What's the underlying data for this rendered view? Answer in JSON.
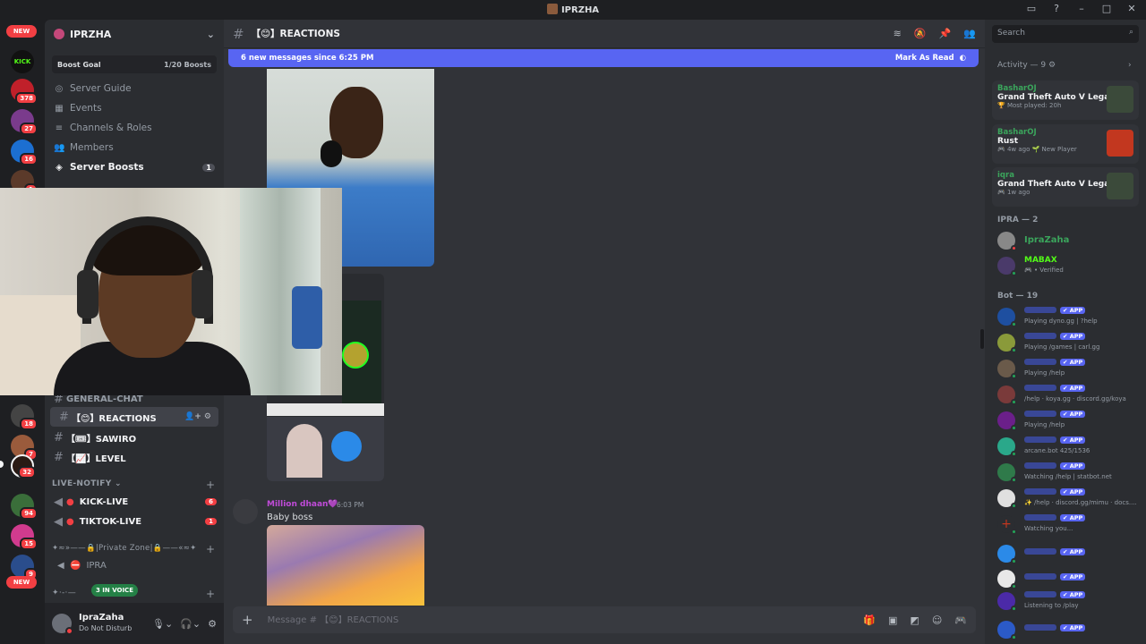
{
  "window": {
    "title": "IPRZHA"
  },
  "rail": {
    "new_label": "NEW",
    "kick_label": "KICK",
    "servers": [
      {
        "badge": "378"
      },
      {
        "badge": "27"
      },
      {
        "badge": "16"
      },
      {
        "badge": "1"
      },
      {
        "badge": "18"
      },
      {
        "badge": "7"
      },
      {
        "badge": "32"
      },
      {
        "badge": "94"
      },
      {
        "badge": "15"
      },
      {
        "badge": "9"
      }
    ],
    "new_label_bottom": "NEW"
  },
  "sidebar": {
    "server_name": "IPRZHA",
    "boost_goal": {
      "label": "Boost Goal",
      "value": "1/20 Boosts"
    },
    "nav": [
      {
        "label": "Server Guide",
        "icon": "compass-icon"
      },
      {
        "label": "Events",
        "icon": "calendar-icon"
      },
      {
        "label": "Channels & Roles",
        "icon": "list-icon"
      },
      {
        "label": "Members",
        "icon": "members-icon"
      },
      {
        "label": "Server Boosts",
        "icon": "boost-icon",
        "count": "1"
      }
    ],
    "channels": [
      {
        "name": "【😊】REACTIONS"
      },
      {
        "name": "【🎟】SAWIRO"
      },
      {
        "name": "【📈】LEVEL"
      }
    ],
    "partial_channel": "GENERAL-CHAT",
    "category_live": "LIVE-NOTIFY ⌄",
    "live_channels": [
      {
        "name": "KICK-LIVE",
        "count": "6"
      },
      {
        "name": "TIKTOK-LIVE",
        "count": "1"
      }
    ],
    "category_private": "✦≈»——🔒|Private Zone|🔒——«≈✦",
    "voice_channel": "IPRA",
    "voice_divider": "✦·-·—",
    "in_voice": "3 IN VOICE",
    "user": {
      "name": "IpraZaha",
      "status": "Do Not Disturb"
    }
  },
  "main": {
    "channel_name": "【😊】REACTIONS",
    "new_messages": "6 new messages since 6:25 PM",
    "mark_as_read": "Mark As Read",
    "message": {
      "author": "Million dhaan💜",
      "time": "6:03 PM",
      "text": "Baby boss"
    },
    "composer_placeholder": "Message # 【😊】REACTIONS"
  },
  "right": {
    "search_placeholder": "Search",
    "activity_header": "Activity — 9",
    "activities": [
      {
        "user": "BasharOJ",
        "game": "Grand Theft Auto V Legacy",
        "meta": "🏆 Most played: 20h",
        "color": "#3b4a3a"
      },
      {
        "user": "BasharOJ",
        "game": "Rust",
        "meta": "🎮 4w ago  🌱 New Player",
        "color": "#c2371f"
      },
      {
        "user": "iqra",
        "game": "Grand Theft Auto V Legacy",
        "meta": "🎮 1w ago",
        "color": "#3b4a3a"
      }
    ],
    "group_ipra": "IPRA — 2",
    "ipra_members": [
      {
        "name": "IpraZaha",
        "sub": ""
      },
      {
        "name": "MABAX",
        "sub": "🎮 • Verified"
      }
    ],
    "group_bot": "Bot — 19",
    "app_badge": "✔ APP",
    "bots": [
      {
        "sub": "Playing dyno.gg | ?help"
      },
      {
        "sub": "Playing /games | carl.gg"
      },
      {
        "sub": "Playing /help"
      },
      {
        "sub": "/help · koya.gg · discord.gg/koya"
      },
      {
        "sub": "Playing /help"
      },
      {
        "sub": "arcane.bot 425/1536"
      },
      {
        "sub": "Watching /help | statbot.net"
      },
      {
        "sub": "✨ /help · discord.gg/mimu · docs...."
      },
      {
        "sub": "Watching you..."
      },
      {
        "sub": ""
      },
      {
        "sub": ""
      },
      {
        "sub": "Listening to /play"
      },
      {
        "sub": ""
      }
    ]
  }
}
